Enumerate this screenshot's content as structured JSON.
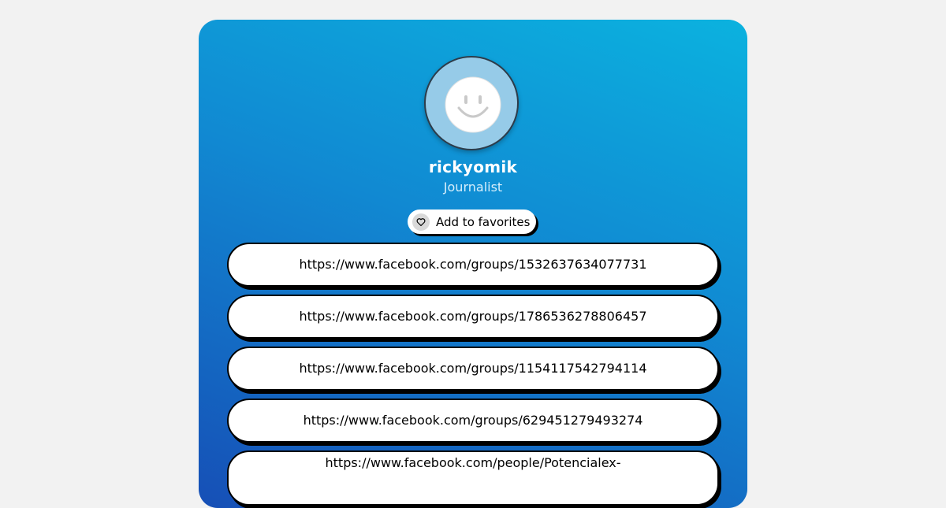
{
  "profile": {
    "username": "rickyomik",
    "role": "Journalist",
    "avatar_icon": "smiley-face-icon"
  },
  "favorites": {
    "label": "Add to favorites",
    "icon": "heart-icon"
  },
  "links": [
    {
      "label": "https://www.facebook.com/groups/1532637634077731"
    },
    {
      "label": "https://www.facebook.com/groups/1786536278806457"
    },
    {
      "label": "https://www.facebook.com/groups/1154117542794114"
    },
    {
      "label": "https://www.facebook.com/groups/629451279493274"
    },
    {
      "label": "https://www.facebook.com/people/Potencialex-"
    }
  ],
  "colors": {
    "page_background": "#f2f2f2",
    "card_gradient_top": "#0bb2df",
    "card_gradient_bottom": "#164fb6",
    "button_background": "#ffffff",
    "button_shadow": "#000000"
  }
}
